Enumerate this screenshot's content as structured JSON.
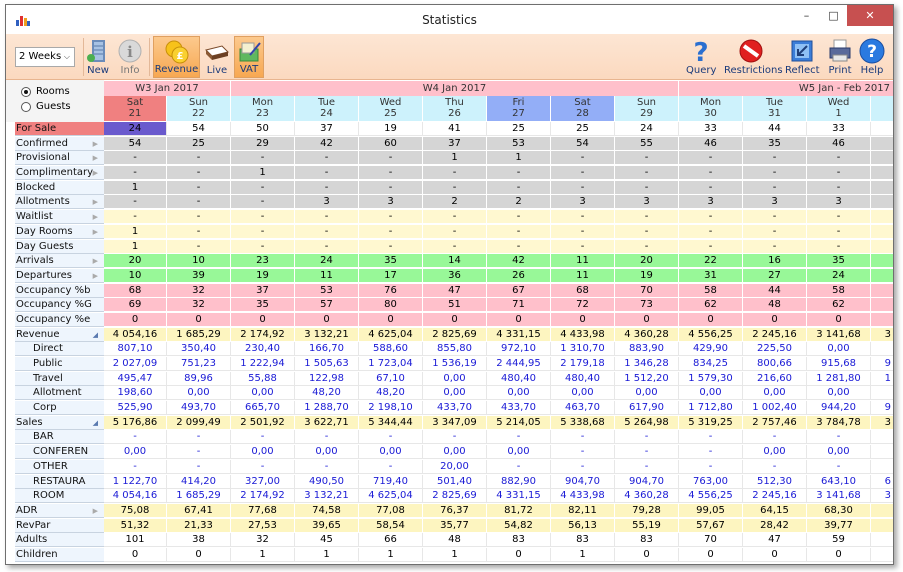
{
  "window": {
    "title": "Statistics"
  },
  "toolbar": {
    "period": "2 Weeks",
    "buttons": [
      {
        "id": "new",
        "label": "New",
        "icon": "building-icon"
      },
      {
        "id": "info",
        "label": "Info",
        "icon": "info-icon"
      },
      {
        "id": "revenue",
        "label": "Revenue",
        "icon": "coins-icon",
        "active": true
      },
      {
        "id": "live",
        "label": "Live",
        "icon": "bed-icon"
      },
      {
        "id": "vat",
        "label": "VAT",
        "icon": "vat-icon",
        "active": true
      },
      {
        "id": "query",
        "label": "Query",
        "icon": "question-icon"
      },
      {
        "id": "restrictions",
        "label": "Restrictions",
        "icon": "no-entry-icon"
      },
      {
        "id": "reflect",
        "label": "Reflect",
        "icon": "reflect-icon"
      },
      {
        "id": "print",
        "label": "Print",
        "icon": "printer-icon"
      },
      {
        "id": "help",
        "label": "Help",
        "icon": "help-icon"
      }
    ]
  },
  "view_mode": {
    "options": [
      "Rooms",
      "Guests"
    ],
    "selected": "Rooms"
  },
  "weeks": [
    {
      "label": "W3 Jan 2017",
      "span": 2
    },
    {
      "label": "W4 Jan 2017",
      "span": 7
    },
    {
      "label": "W5 Jan - Feb 2017",
      "span": 4
    }
  ],
  "days": [
    {
      "dow": "Sat",
      "day": "21",
      "style": "weekend-sel"
    },
    {
      "dow": "Sun",
      "day": "22"
    },
    {
      "dow": "Mon",
      "day": "23"
    },
    {
      "dow": "Tue",
      "day": "24"
    },
    {
      "dow": "Wed",
      "day": "25"
    },
    {
      "dow": "Thu",
      "day": "26"
    },
    {
      "dow": "Fri",
      "day": "27",
      "style": "sel"
    },
    {
      "dow": "Sat",
      "day": "28",
      "style": "sel"
    },
    {
      "dow": "Sun",
      "day": "29"
    },
    {
      "dow": "Mon",
      "day": "30"
    },
    {
      "dow": "Tue",
      "day": "31"
    },
    {
      "dow": "Wed",
      "day": "1"
    },
    {
      "dow": "",
      "day": ""
    }
  ],
  "rows": [
    {
      "label": "For Sale",
      "bg": "white",
      "special": "forsale",
      "values": [
        "24",
        "54",
        "50",
        "37",
        "19",
        "41",
        "25",
        "25",
        "24",
        "33",
        "44",
        "33",
        ""
      ]
    },
    {
      "label": "Confirmed",
      "bg": "grey",
      "expand": true,
      "values": [
        "54",
        "25",
        "29",
        "42",
        "60",
        "37",
        "53",
        "54",
        "55",
        "46",
        "35",
        "46",
        ""
      ]
    },
    {
      "label": "Provisional",
      "bg": "grey",
      "expand": true,
      "values": [
        "-",
        "-",
        "-",
        "-",
        "-",
        "1",
        "1",
        "-",
        "-",
        "-",
        "-",
        "-",
        ""
      ]
    },
    {
      "label": "Complimentary",
      "bg": "grey",
      "expand": true,
      "values": [
        "-",
        "-",
        "1",
        "-",
        "-",
        "-",
        "-",
        "-",
        "-",
        "-",
        "-",
        "-",
        ""
      ]
    },
    {
      "label": "Blocked",
      "bg": "grey",
      "values": [
        "1",
        "-",
        "-",
        "-",
        "-",
        "-",
        "-",
        "-",
        "-",
        "-",
        "-",
        "-",
        ""
      ]
    },
    {
      "label": "Allotments",
      "bg": "grey",
      "expand": true,
      "values": [
        "-",
        "-",
        "-",
        "3",
        "3",
        "2",
        "2",
        "3",
        "3",
        "3",
        "3",
        "3",
        ""
      ]
    },
    {
      "label": "Waitlist",
      "bg": "yellow",
      "expand": true,
      "values": [
        "-",
        "-",
        "-",
        "-",
        "-",
        "-",
        "-",
        "-",
        "-",
        "-",
        "-",
        "-",
        ""
      ]
    },
    {
      "label": "Day Rooms",
      "bg": "yellow",
      "expand": true,
      "values": [
        "1",
        "-",
        "-",
        "-",
        "-",
        "-",
        "-",
        "-",
        "-",
        "-",
        "-",
        "-",
        ""
      ]
    },
    {
      "label": "Day Guests",
      "bg": "yellow",
      "values": [
        "1",
        "-",
        "-",
        "-",
        "-",
        "-",
        "-",
        "-",
        "-",
        "-",
        "-",
        "-",
        ""
      ]
    },
    {
      "label": "Arrivals",
      "bg": "green",
      "expand": true,
      "values": [
        "20",
        "10",
        "23",
        "24",
        "35",
        "14",
        "42",
        "11",
        "20",
        "22",
        "16",
        "35",
        ""
      ]
    },
    {
      "label": "Departures",
      "bg": "green",
      "expand": true,
      "values": [
        "10",
        "39",
        "19",
        "11",
        "17",
        "36",
        "26",
        "11",
        "19",
        "31",
        "27",
        "24",
        ""
      ]
    },
    {
      "label": "Occupancy %b",
      "bg": "pink",
      "values": [
        "68",
        "32",
        "37",
        "53",
        "76",
        "47",
        "67",
        "68",
        "70",
        "58",
        "44",
        "58",
        ""
      ]
    },
    {
      "label": "Occupancy %G",
      "bg": "pink",
      "values": [
        "69",
        "32",
        "35",
        "57",
        "80",
        "51",
        "71",
        "72",
        "73",
        "62",
        "48",
        "62",
        ""
      ]
    },
    {
      "label": "Occupancy %e",
      "bg": "pink",
      "values": [
        "0",
        "0",
        "0",
        "0",
        "0",
        "0",
        "0",
        "0",
        "0",
        "0",
        "0",
        "0",
        ""
      ]
    },
    {
      "label": "Revenue",
      "bg": "revyel",
      "collapse": true,
      "values": [
        "4 054,16",
        "1 685,29",
        "2 174,92",
        "3 132,21",
        "4 625,04",
        "2 825,69",
        "4 331,15",
        "4 433,98",
        "4 360,28",
        "4 556,25",
        "2 245,16",
        "3 141,68",
        "3"
      ]
    },
    {
      "label": "Direct",
      "bg": "white",
      "sub": true,
      "blue": true,
      "values": [
        "807,10",
        "350,40",
        "230,40",
        "166,70",
        "588,60",
        "855,80",
        "972,10",
        "1 310,70",
        "883,90",
        "429,90",
        "225,50",
        "0,00",
        ""
      ]
    },
    {
      "label": "Public",
      "bg": "white",
      "sub": true,
      "blue": true,
      "values": [
        "2 027,09",
        "751,23",
        "1 222,94",
        "1 505,63",
        "1 723,04",
        "1 536,19",
        "2 444,95",
        "2 179,18",
        "1 346,28",
        "834,25",
        "800,66",
        "915,68",
        "9"
      ]
    },
    {
      "label": "Travel",
      "bg": "white",
      "sub": true,
      "blue": true,
      "values": [
        "495,47",
        "89,96",
        "55,88",
        "122,98",
        "67,10",
        "0,00",
        "480,40",
        "480,40",
        "1 512,20",
        "1 579,30",
        "216,60",
        "1 281,80",
        "1"
      ]
    },
    {
      "label": "Allotment",
      "bg": "white",
      "sub": true,
      "blue": true,
      "values": [
        "198,60",
        "0,00",
        "0,00",
        "48,20",
        "48,20",
        "0,00",
        "0,00",
        "0,00",
        "0,00",
        "0,00",
        "0,00",
        "0,00",
        ""
      ]
    },
    {
      "label": "Corp",
      "bg": "white",
      "sub": true,
      "blue": true,
      "values": [
        "525,90",
        "493,70",
        "665,70",
        "1 288,70",
        "2 198,10",
        "433,70",
        "433,70",
        "463,70",
        "617,90",
        "1 712,80",
        "1 002,40",
        "944,20",
        "9"
      ]
    },
    {
      "label": "Sales",
      "bg": "revyel",
      "collapse": true,
      "values": [
        "5 176,86",
        "2 099,49",
        "2 501,92",
        "3 622,71",
        "5 344,44",
        "3 347,09",
        "5 214,05",
        "5 338,68",
        "5 264,98",
        "5 319,25",
        "2 757,46",
        "3 784,78",
        "3"
      ]
    },
    {
      "label": "BAR",
      "bg": "white",
      "sub": true,
      "blue": true,
      "values": [
        "-",
        "-",
        "-",
        "-",
        "-",
        "-",
        "-",
        "-",
        "-",
        "-",
        "-",
        "-",
        ""
      ]
    },
    {
      "label": "CONFEREN",
      "bg": "white",
      "sub": true,
      "blue": true,
      "values": [
        "0,00",
        "-",
        "0,00",
        "0,00",
        "0,00",
        "0,00",
        "0,00",
        "-",
        "-",
        "-",
        "0,00",
        "0,00",
        ""
      ]
    },
    {
      "label": "OTHER",
      "bg": "white",
      "sub": true,
      "blue": true,
      "values": [
        "-",
        "-",
        "-",
        "-",
        "-",
        "20,00",
        "-",
        "-",
        "-",
        "-",
        "-",
        "-",
        ""
      ]
    },
    {
      "label": "RESTAURA",
      "bg": "white",
      "sub": true,
      "blue": true,
      "values": [
        "1 122,70",
        "414,20",
        "327,00",
        "490,50",
        "719,40",
        "501,40",
        "882,90",
        "904,70",
        "904,70",
        "763,00",
        "512,30",
        "643,10",
        "6"
      ]
    },
    {
      "label": "ROOM",
      "bg": "white",
      "sub": true,
      "blue": true,
      "values": [
        "4 054,16",
        "1 685,29",
        "2 174,92",
        "3 132,21",
        "4 625,04",
        "2 825,69",
        "4 331,15",
        "4 433,98",
        "4 360,28",
        "4 556,25",
        "2 245,16",
        "3 141,68",
        "3"
      ]
    },
    {
      "label": "ADR",
      "bg": "revyel",
      "expand": true,
      "values": [
        "75,08",
        "67,41",
        "77,68",
        "74,58",
        "77,08",
        "76,37",
        "81,72",
        "82,11",
        "79,28",
        "99,05",
        "64,15",
        "68,30",
        ""
      ]
    },
    {
      "label": "RevPar",
      "bg": "revyel",
      "values": [
        "51,32",
        "21,33",
        "27,53",
        "39,65",
        "58,54",
        "35,77",
        "54,82",
        "56,13",
        "55,19",
        "57,67",
        "28,42",
        "39,77",
        ""
      ]
    },
    {
      "label": "Adults",
      "bg": "white",
      "values": [
        "101",
        "38",
        "32",
        "45",
        "66",
        "48",
        "83",
        "83",
        "83",
        "70",
        "47",
        "59",
        ""
      ]
    },
    {
      "label": "Children",
      "bg": "white",
      "values": [
        "0",
        "0",
        "1",
        "1",
        "1",
        "1",
        "0",
        "1",
        "0",
        "0",
        "0",
        "0",
        ""
      ]
    }
  ]
}
